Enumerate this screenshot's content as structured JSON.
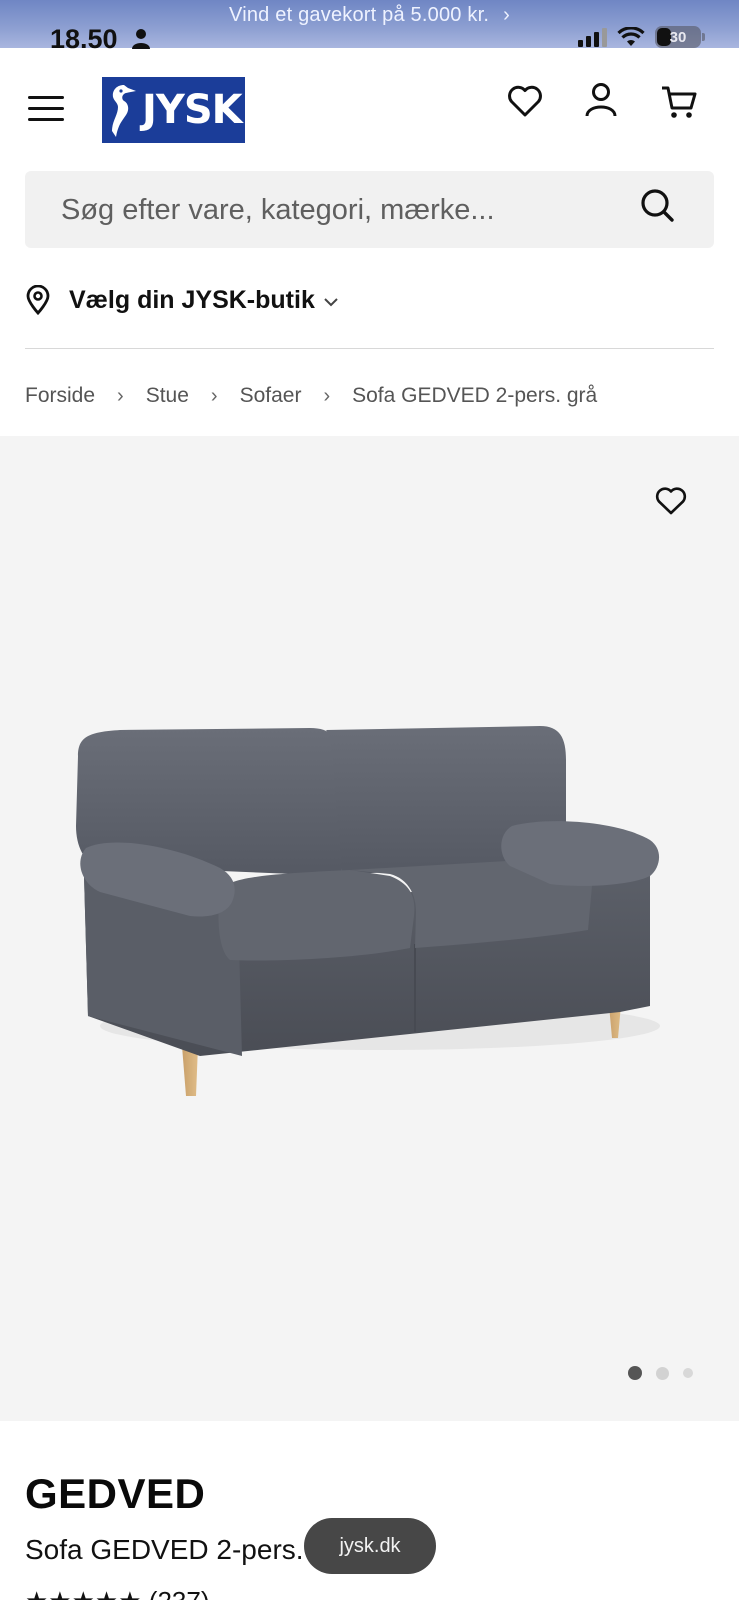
{
  "promo": {
    "text": "Vind et gavekort på 5.000 kr.",
    "chevron": "›"
  },
  "status_bar": {
    "time": "18.50",
    "battery": "30"
  },
  "header": {
    "logo_text": "JYSK"
  },
  "search": {
    "placeholder": "Søg efter vare, kategori, mærke..."
  },
  "store_selector": {
    "label": "Vælg din JYSK-butik"
  },
  "breadcrumb": {
    "items": [
      "Forside",
      "Stue",
      "Sofaer",
      "Sofa GEDVED 2-pers. grå"
    ],
    "separator": "›"
  },
  "gallery": {
    "image_count": 3,
    "active_index": 0
  },
  "product": {
    "name": "GEDVED",
    "description": "Sofa GEDVED 2-pers.",
    "rating_stars": "★★★★★",
    "review_count": "(237)"
  },
  "browser": {
    "url": "jysk.dk"
  },
  "colors": {
    "brand_blue": "#1b3d99",
    "promo_bg": "#8ea0d2",
    "hero_bg": "#f4f4f4",
    "pill_bg": "#474747"
  },
  "icons": [
    "menu-icon",
    "heart-icon",
    "user-icon",
    "cart-icon",
    "search-icon",
    "location-pin-icon",
    "chevron-down-icon",
    "chevron-right-icon"
  ]
}
